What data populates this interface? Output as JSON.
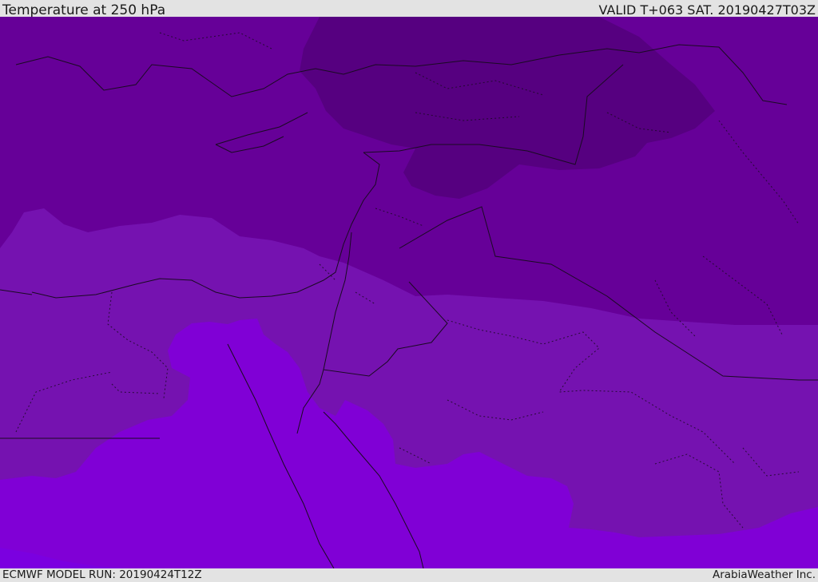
{
  "header": {
    "title": "Temperature at 250 hPa",
    "valid_time": "VALID T+063 SAT. 20190427T03Z"
  },
  "footer": {
    "model_run": "ECMWF MODEL RUN: 20190424T12Z",
    "credit": "ArabiaWeather Inc."
  },
  "map": {
    "field": "temperature-250hPa",
    "palette": {
      "coldest": "#560080",
      "colder": "#660098",
      "mid": "#7512b0",
      "warm": "#8000d6",
      "warmest": "#7b00e0",
      "borders": "#1a0a22"
    }
  }
}
